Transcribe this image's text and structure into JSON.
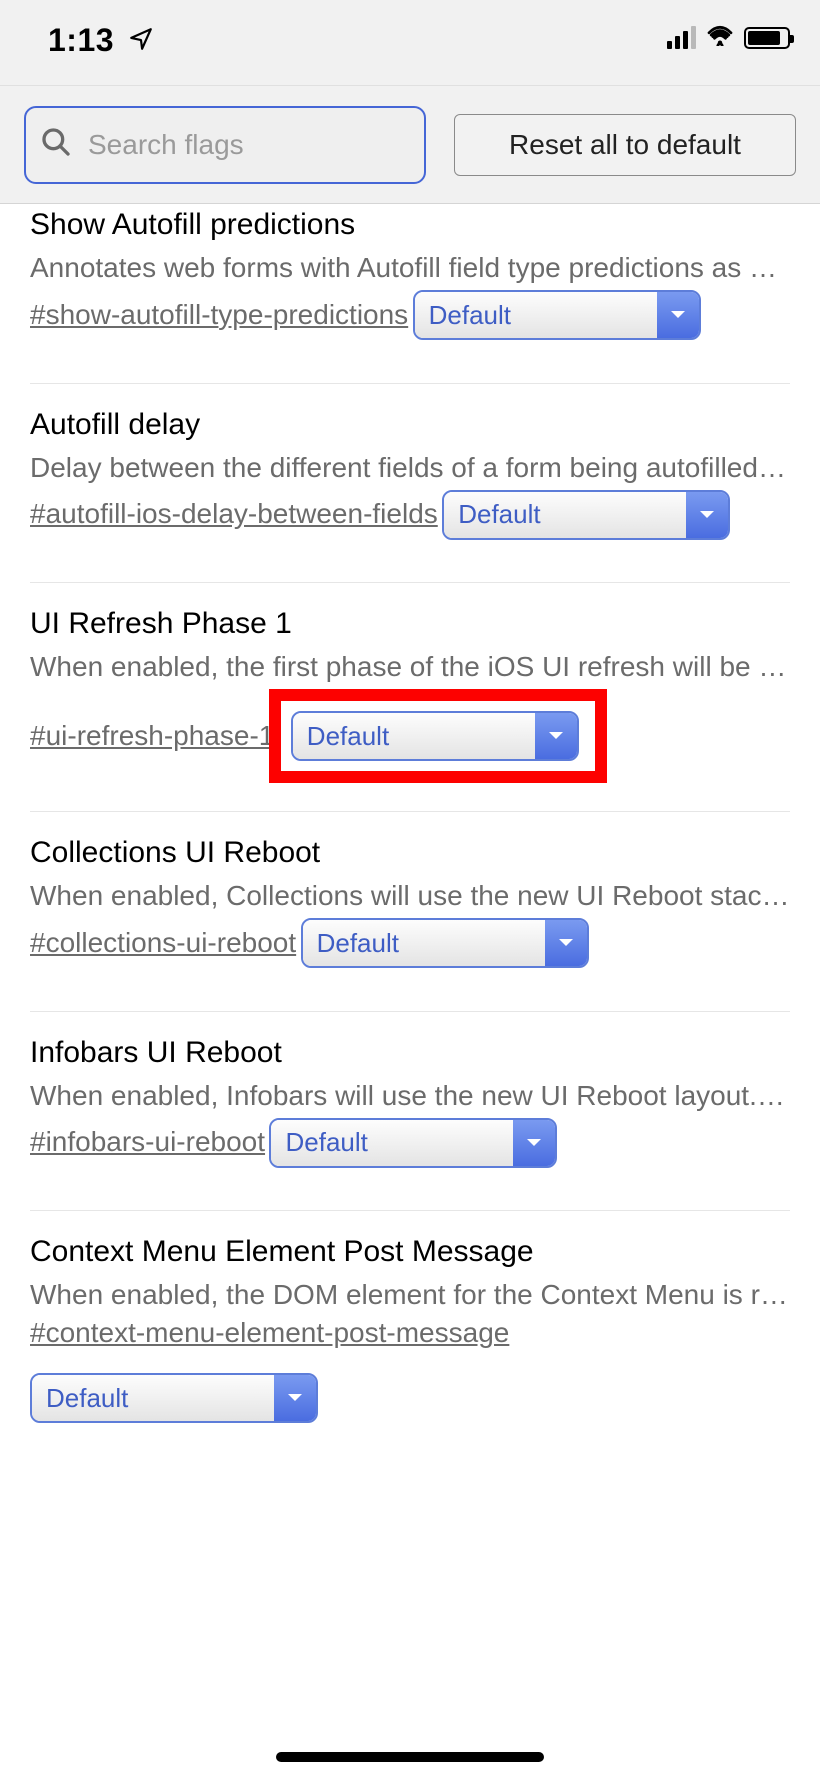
{
  "status": {
    "time": "1:13"
  },
  "header": {
    "search_placeholder": "Search flags",
    "reset_label": "Reset all to default"
  },
  "flags": [
    {
      "title": "Show Autofill predictions",
      "desc": "Annotates web forms with Autofill field type predictions as pl…",
      "hash": "#show-autofill-type-predictions",
      "value": "Default",
      "highlight": false
    },
    {
      "title": "Autofill delay",
      "desc": "Delay between the different fields of a form being autofilled. …",
      "hash": "#autofill-ios-delay-between-fields",
      "value": "Default",
      "highlight": false
    },
    {
      "title": "UI Refresh Phase 1",
      "desc": "When enabled, the first phase of the iOS UI refresh will be d…",
      "hash": "#ui-refresh-phase-1",
      "value": "Default",
      "highlight": true
    },
    {
      "title": "Collections UI Reboot",
      "desc": "When enabled, Collections will use the new UI Reboot stac…",
      "hash": "#collections-ui-reboot",
      "value": "Default",
      "highlight": false
    },
    {
      "title": "Infobars UI Reboot",
      "desc": "When enabled, Infobars will use the new UI Reboot layout. …",
      "hash": "#infobars-ui-reboot",
      "value": "Default",
      "highlight": false
    },
    {
      "title": "Context Menu Element Post Message",
      "desc": "When enabled, the DOM element for the Context Menu is r…",
      "hash": "#context-menu-element-post-message",
      "value": "Default",
      "highlight": false
    }
  ]
}
